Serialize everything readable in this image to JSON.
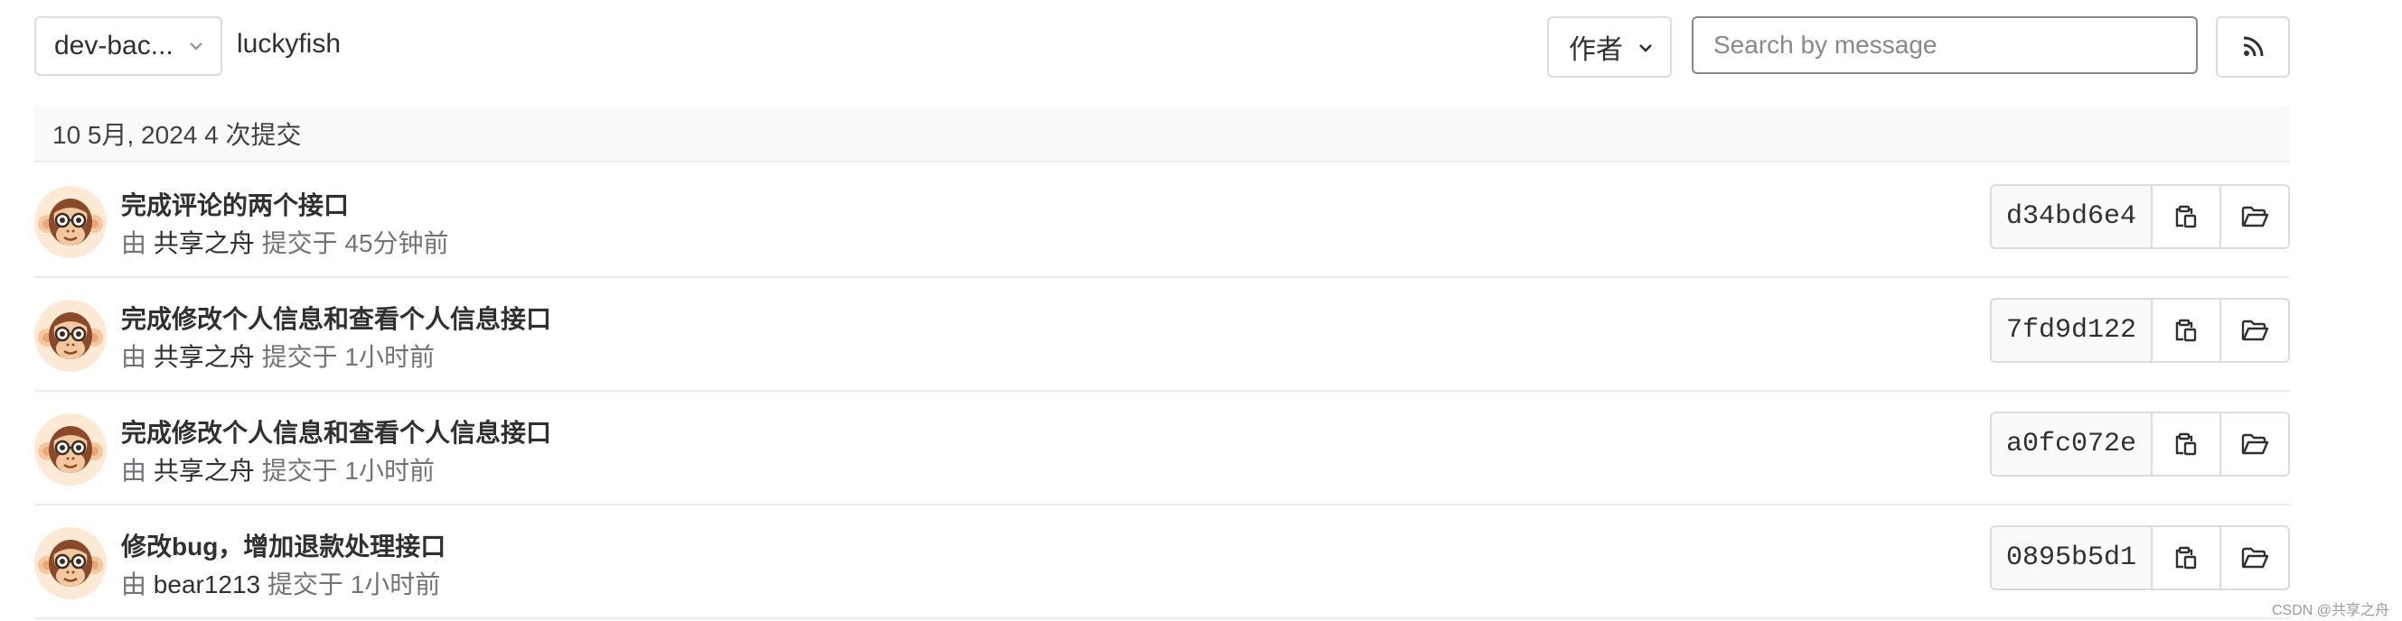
{
  "toolbar": {
    "branch": "dev-bac...",
    "path": "luckyfish",
    "author_filter": "作者",
    "search_placeholder": "Search by message"
  },
  "day_header": "10 5月, 2024 4 次提交",
  "commits": [
    {
      "title": "完成评论的两个接口",
      "by": "由",
      "author": "共享之舟",
      "committed": "提交于 45分钟前",
      "sha": "d34bd6e4"
    },
    {
      "title": "完成修改个人信息和查看个人信息接口",
      "by": "由",
      "author": "共享之舟",
      "committed": "提交于 1小时前",
      "sha": "7fd9d122"
    },
    {
      "title": "完成修改个人信息和查看个人信息接口",
      "by": "由",
      "author": "共享之舟",
      "committed": "提交于 1小时前",
      "sha": "a0fc072e"
    },
    {
      "title": "修改bug，增加退款处理接口",
      "by": "由",
      "author": "bear1213",
      "committed": "提交于 1小时前",
      "sha": "0895b5d1"
    }
  ],
  "icons": {
    "branch_dropdown": "chevron-down-icon",
    "rss": "rss-icon",
    "avatar": "monkey-avatar",
    "copy": "clipboard-icon",
    "browse": "folder-open-icon"
  },
  "watermark": "CSDN @共享之舟"
}
